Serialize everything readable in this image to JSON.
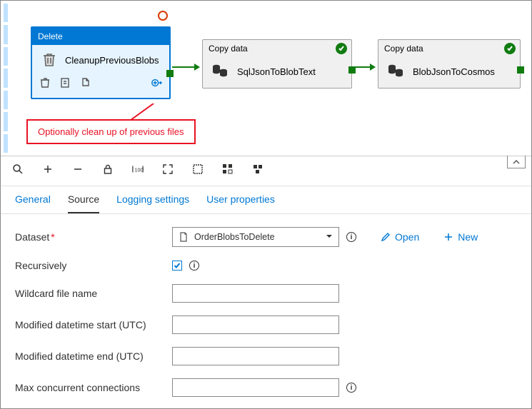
{
  "canvas": {
    "delete": {
      "header": "Delete",
      "name": "CleanupPreviousBlobs"
    },
    "copy1": {
      "header": "Copy data",
      "name": "SqlJsonToBlobText"
    },
    "copy2": {
      "header": "Copy data",
      "name": "BlobJsonToCosmos"
    },
    "callout": "Optionally clean up of previous files"
  },
  "tabs": {
    "general": "General",
    "source": "Source",
    "logging": "Logging settings",
    "user": "User properties"
  },
  "form": {
    "dataset_label": "Dataset",
    "dataset_value": "OrderBlobsToDelete",
    "open": "Open",
    "new": "New",
    "recursively": "Recursively",
    "wildcard": "Wildcard file name",
    "mod_start": "Modified datetime start (UTC)",
    "mod_end": "Modified datetime end (UTC)",
    "max_conn": "Max concurrent connections"
  }
}
